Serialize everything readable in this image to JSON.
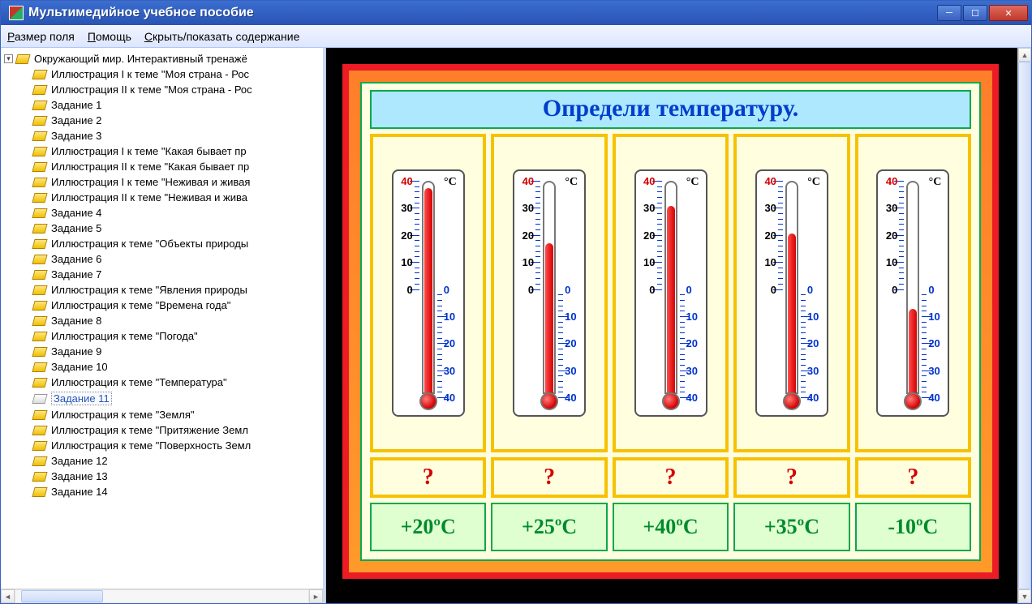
{
  "window": {
    "title": "Мультимедийное учебное пособие"
  },
  "menu": {
    "items": [
      {
        "pre": "Р",
        "rest": "азмер поля"
      },
      {
        "pre": "П",
        "rest": "омощь"
      },
      {
        "pre": "С",
        "rest": "крыть/показать содержание"
      }
    ]
  },
  "tree": {
    "root": "Окружающий мир. Интерактивный тренажё",
    "items": [
      "Иллюстрация I к теме \"Моя страна - Рос",
      "Иллюстрация II к теме \"Моя страна - Рос",
      "Задание 1",
      "Задание 2",
      "Задание 3",
      "Иллюстрация I к теме \"Какая бывает пр",
      "Иллюстрация II к теме \"Какая бывает пр",
      "Иллюстрация I к теме \"Неживая и живая",
      "Иллюстрация II к теме \"Неживая и жива",
      "Задание 4",
      "Задание 5",
      "Иллюстрация к теме \"Объекты природы",
      "Задание 6",
      "Задание 7",
      "Иллюстрация к теме \"Явления природы",
      "Иллюстрация к теме \"Времена года\"",
      "Задание 8",
      "Иллюстрация к теме \"Погода\"",
      "Задание 9",
      "Задание 10",
      "Иллюстрация к теме \"Температура\"",
      "Задание 11",
      "Иллюстрация к теме \"Земля\"",
      "Иллюстрация к теме \"Притяжение Земл",
      "Иллюстрация к теме \"Поверхность Земл",
      "Задание 12",
      "Задание 13",
      "Задание 14"
    ],
    "selectedIndex": 21
  },
  "task": {
    "title": "Определи температуру.",
    "unit": "°C",
    "qmark": "?",
    "thermometers": [
      {
        "value": 40
      },
      {
        "value": 18
      },
      {
        "value": 33
      },
      {
        "value": 22
      },
      {
        "value": -8
      }
    ],
    "answers": [
      "+20ºC",
      "+25ºC",
      "+40ºC",
      "+35ºC",
      "-10ºC"
    ],
    "scale": {
      "left": {
        "40": "40",
        "30": "30",
        "20": "20",
        "10": "10",
        "0": "0"
      },
      "right": {
        "0": "0",
        "-10": "10",
        "-20": "20",
        "-30": "30",
        "-40": "40"
      }
    }
  }
}
